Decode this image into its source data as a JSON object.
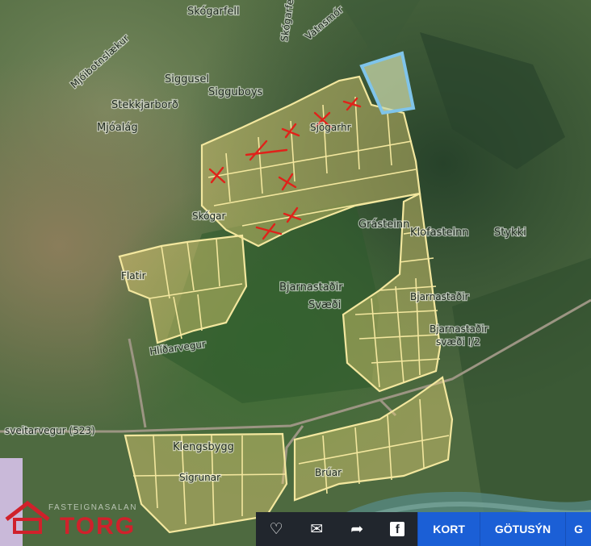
{
  "map": {
    "labels": {
      "skogarfell": "Skógarfell",
      "mjoibotnslaekur": "Mjóibotnslækur",
      "siggusel": "Siggusel",
      "sigguboys": "Sigguboys",
      "stekkjarbord": "Stekkjarborð",
      "mjoalag": "Mjóalág",
      "skogar": "Skógar",
      "sjogarhraun": "Sjögarhr",
      "gratsteinn": "Grásteinn",
      "klofasteinn": "Klofasteinn",
      "stykki": "Stykki",
      "flatir": "Flatir",
      "bjarnastadir": "Bjarnastaðir",
      "svaedi": "Svæði",
      "bjarnastadir2": "Bjarnastaðir",
      "bjarnastadir3": "Bjarnastaðir",
      "svaedi_ii": "svæði I/2",
      "hlidarvegur": "Hlíðarvegur",
      "sveitarvegur": "sveitarvegur (523)",
      "klengsbygg": "Klengsbygg",
      "sigrunar": "Sigrunar",
      "bruar": "Brúar",
      "vatnsskardsvegur": "Vatnsmór"
    }
  },
  "logo": {
    "brand": "TORG",
    "tagline": "FASTEIGNASALAN"
  },
  "toolbar": {
    "heart_icon": "heart-icon",
    "mail_icon": "mail-icon",
    "share_icon": "share-icon",
    "facebook_icon": "facebook-icon",
    "kort": "KORT",
    "gotusyn": "GÖTUSÝN",
    "more": "G"
  },
  "colors": {
    "lot_outline": "#f3e79e",
    "selected_lot": "#7fc4ea",
    "x_mark": "#e0221a",
    "toolbar_blue": "#1b5fd6",
    "toolbar_dark": "#21262d",
    "brand_red": "#d0212b"
  }
}
